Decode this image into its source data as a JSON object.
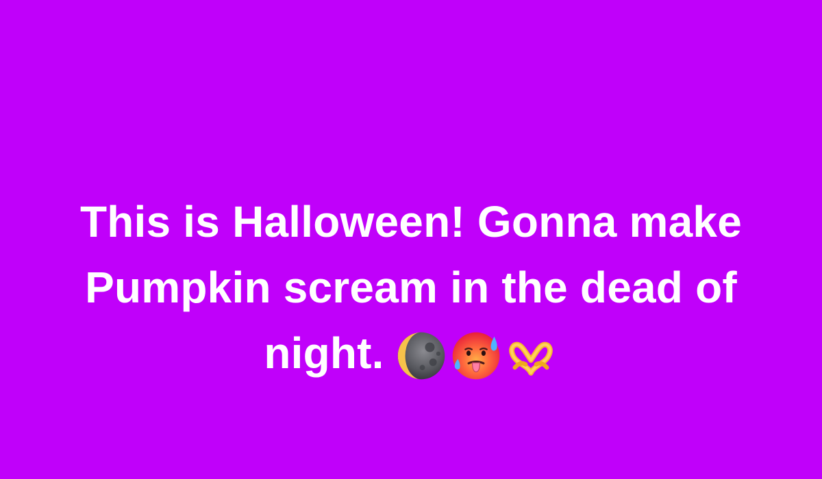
{
  "post": {
    "background_color": "#c000fa",
    "text_color": "#ffffff",
    "lines": [
      "This is Halloween! Gonna make",
      "Pumpkin scream in the dead of",
      "night."
    ],
    "emojis": [
      "last-quarter-moon-face-icon",
      "hot-face-icon",
      "heart-hands-icon"
    ]
  }
}
